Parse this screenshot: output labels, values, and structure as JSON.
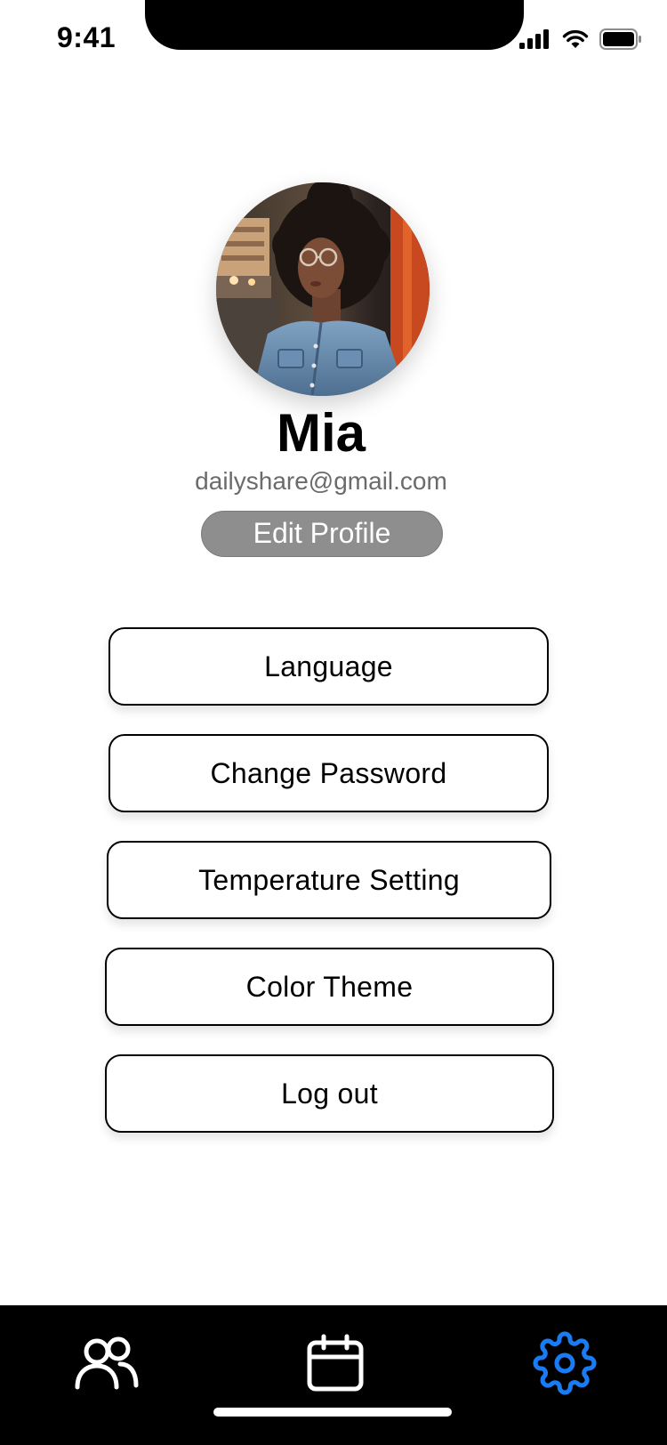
{
  "status_bar": {
    "time": "9:41",
    "icons": [
      "cellular-signal-icon",
      "wifi-icon",
      "battery-icon"
    ]
  },
  "profile": {
    "name": "Mia",
    "email": "dailyshare@gmail.com",
    "edit_label": "Edit Profile"
  },
  "menu": [
    {
      "label": "Language"
    },
    {
      "label": "Change Password"
    },
    {
      "label": "Temperature Setting"
    },
    {
      "label": "Color Theme"
    },
    {
      "label": "Log out"
    }
  ],
  "tab_bar": {
    "tabs": [
      {
        "icon": "people-icon",
        "active": false
      },
      {
        "icon": "calendar-icon",
        "active": false
      },
      {
        "icon": "gear-icon",
        "active": true
      }
    ],
    "active_color": "#1a7cf5",
    "inactive_color": "#ffffff"
  }
}
